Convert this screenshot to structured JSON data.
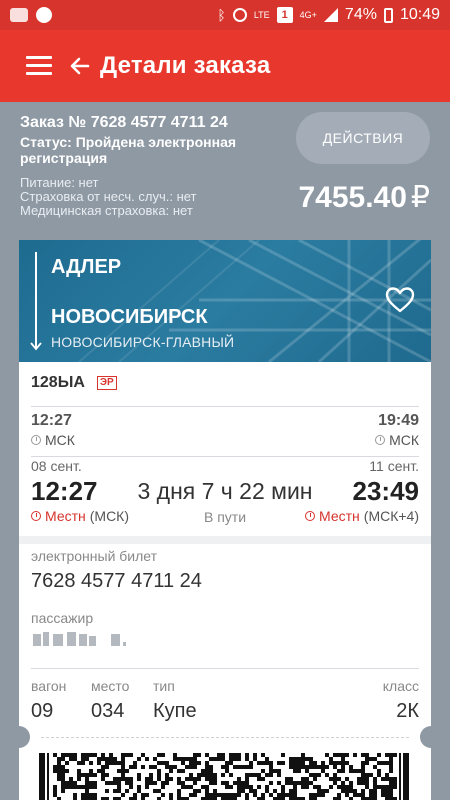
{
  "status_bar": {
    "battery": "74%",
    "time": "10:49",
    "network_lte": "LTE",
    "network_4g": "4G+",
    "sim_label": "1"
  },
  "app_bar": {
    "title": "Детали заказа"
  },
  "order": {
    "number_text": "Заказ № 7628 4577 4711 24",
    "status_text": "Статус: Пройдена электронная регистрация",
    "actions_label": "ДЕЙСТВИЯ",
    "options": [
      "Питание: нет",
      "Страховка от несч. случ.: нет",
      "Медицинская страховка: нет"
    ],
    "price": "7455.40",
    "currency": "₽"
  },
  "route": {
    "from": "АДЛЕР",
    "to": "НОВОСИБИРСК",
    "station": "НОВОСИБИРСК-ГЛАВНЫЙ"
  },
  "train": {
    "number": "128ЫА",
    "badge": "ЭР"
  },
  "schedule": {
    "dep_msk_time": "12:27",
    "arr_msk_time": "19:49",
    "msk_label": "МСК",
    "dep_date": "08 сент.",
    "arr_date": "11 сент.",
    "dep_local_time": "12:27",
    "arr_local_time": "23:49",
    "duration": "3 дня 7 ч 22 мин",
    "en_route": "В пути",
    "local_label": "Местн",
    "dep_tz": "(МСК)",
    "arr_tz": "(МСК+4)"
  },
  "ticket": {
    "e_ticket_label": "электронный билет",
    "e_ticket_number": "7628 4577 4711 24",
    "passenger_label": "пассажир"
  },
  "seat": {
    "wagon_label": "вагон",
    "wagon": "09",
    "place_label": "место",
    "place": "034",
    "type_label": "тип",
    "type": "Купе",
    "class_label": "класс",
    "class": "2К"
  },
  "colors": {
    "primary_red": "#e8372d",
    "status_red": "#d6342c",
    "header_gray": "#8e99a4",
    "route_blue": "#2b7ca1"
  }
}
